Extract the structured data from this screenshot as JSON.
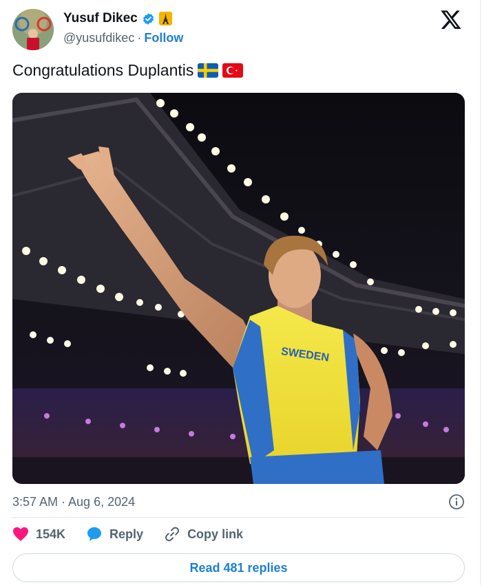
{
  "author": {
    "name": "Yusuf Dikec",
    "handle": "@yusufdikec",
    "separator": "·",
    "follow_label": "Follow",
    "verified_icon": "verified-badge-icon",
    "affiliate_icon": "eiffel-tower-badge-icon"
  },
  "tweet": {
    "text": "Congratulations Duplantis",
    "flags": [
      "sweden-flag",
      "turkey-flag"
    ],
    "photo_jersey_text": "SWEDEN"
  },
  "meta": {
    "timestamp": "3:57 AM · Aug 6, 2024"
  },
  "actions": {
    "likes_count": "154K",
    "reply_label": "Reply",
    "copy_link_label": "Copy link"
  },
  "footer": {
    "read_replies_label": "Read 481 replies"
  },
  "colors": {
    "accent": "#1d9bf0",
    "like": "#f91880",
    "text": "#0f1419",
    "muted": "#536471"
  }
}
